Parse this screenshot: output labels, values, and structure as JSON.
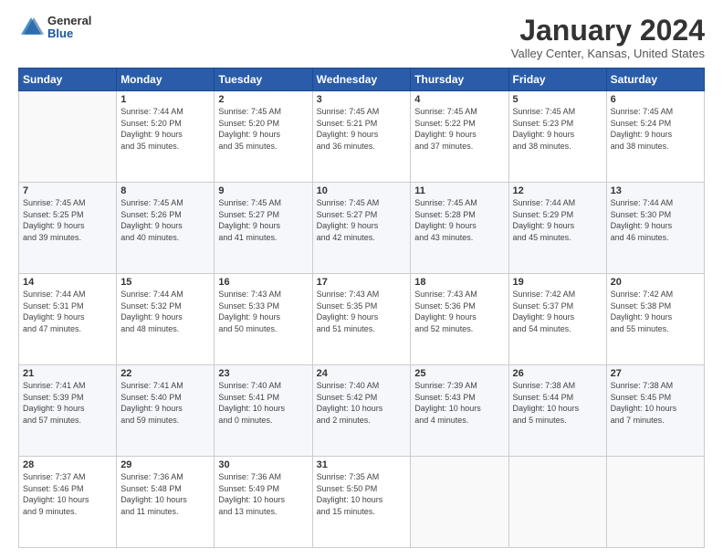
{
  "logo": {
    "general": "General",
    "blue": "Blue"
  },
  "header": {
    "title": "January 2024",
    "location": "Valley Center, Kansas, United States"
  },
  "days_of_week": [
    "Sunday",
    "Monday",
    "Tuesday",
    "Wednesday",
    "Thursday",
    "Friday",
    "Saturday"
  ],
  "weeks": [
    [
      {
        "day": "",
        "info": ""
      },
      {
        "day": "1",
        "info": "Sunrise: 7:44 AM\nSunset: 5:20 PM\nDaylight: 9 hours\nand 35 minutes."
      },
      {
        "day": "2",
        "info": "Sunrise: 7:45 AM\nSunset: 5:20 PM\nDaylight: 9 hours\nand 35 minutes."
      },
      {
        "day": "3",
        "info": "Sunrise: 7:45 AM\nSunset: 5:21 PM\nDaylight: 9 hours\nand 36 minutes."
      },
      {
        "day": "4",
        "info": "Sunrise: 7:45 AM\nSunset: 5:22 PM\nDaylight: 9 hours\nand 37 minutes."
      },
      {
        "day": "5",
        "info": "Sunrise: 7:45 AM\nSunset: 5:23 PM\nDaylight: 9 hours\nand 38 minutes."
      },
      {
        "day": "6",
        "info": "Sunrise: 7:45 AM\nSunset: 5:24 PM\nDaylight: 9 hours\nand 38 minutes."
      }
    ],
    [
      {
        "day": "7",
        "info": "Sunrise: 7:45 AM\nSunset: 5:25 PM\nDaylight: 9 hours\nand 39 minutes."
      },
      {
        "day": "8",
        "info": "Sunrise: 7:45 AM\nSunset: 5:26 PM\nDaylight: 9 hours\nand 40 minutes."
      },
      {
        "day": "9",
        "info": "Sunrise: 7:45 AM\nSunset: 5:27 PM\nDaylight: 9 hours\nand 41 minutes."
      },
      {
        "day": "10",
        "info": "Sunrise: 7:45 AM\nSunset: 5:27 PM\nDaylight: 9 hours\nand 42 minutes."
      },
      {
        "day": "11",
        "info": "Sunrise: 7:45 AM\nSunset: 5:28 PM\nDaylight: 9 hours\nand 43 minutes."
      },
      {
        "day": "12",
        "info": "Sunrise: 7:44 AM\nSunset: 5:29 PM\nDaylight: 9 hours\nand 45 minutes."
      },
      {
        "day": "13",
        "info": "Sunrise: 7:44 AM\nSunset: 5:30 PM\nDaylight: 9 hours\nand 46 minutes."
      }
    ],
    [
      {
        "day": "14",
        "info": "Sunrise: 7:44 AM\nSunset: 5:31 PM\nDaylight: 9 hours\nand 47 minutes."
      },
      {
        "day": "15",
        "info": "Sunrise: 7:44 AM\nSunset: 5:32 PM\nDaylight: 9 hours\nand 48 minutes."
      },
      {
        "day": "16",
        "info": "Sunrise: 7:43 AM\nSunset: 5:33 PM\nDaylight: 9 hours\nand 50 minutes."
      },
      {
        "day": "17",
        "info": "Sunrise: 7:43 AM\nSunset: 5:35 PM\nDaylight: 9 hours\nand 51 minutes."
      },
      {
        "day": "18",
        "info": "Sunrise: 7:43 AM\nSunset: 5:36 PM\nDaylight: 9 hours\nand 52 minutes."
      },
      {
        "day": "19",
        "info": "Sunrise: 7:42 AM\nSunset: 5:37 PM\nDaylight: 9 hours\nand 54 minutes."
      },
      {
        "day": "20",
        "info": "Sunrise: 7:42 AM\nSunset: 5:38 PM\nDaylight: 9 hours\nand 55 minutes."
      }
    ],
    [
      {
        "day": "21",
        "info": "Sunrise: 7:41 AM\nSunset: 5:39 PM\nDaylight: 9 hours\nand 57 minutes."
      },
      {
        "day": "22",
        "info": "Sunrise: 7:41 AM\nSunset: 5:40 PM\nDaylight: 9 hours\nand 59 minutes."
      },
      {
        "day": "23",
        "info": "Sunrise: 7:40 AM\nSunset: 5:41 PM\nDaylight: 10 hours\nand 0 minutes."
      },
      {
        "day": "24",
        "info": "Sunrise: 7:40 AM\nSunset: 5:42 PM\nDaylight: 10 hours\nand 2 minutes."
      },
      {
        "day": "25",
        "info": "Sunrise: 7:39 AM\nSunset: 5:43 PM\nDaylight: 10 hours\nand 4 minutes."
      },
      {
        "day": "26",
        "info": "Sunrise: 7:38 AM\nSunset: 5:44 PM\nDaylight: 10 hours\nand 5 minutes."
      },
      {
        "day": "27",
        "info": "Sunrise: 7:38 AM\nSunset: 5:45 PM\nDaylight: 10 hours\nand 7 minutes."
      }
    ],
    [
      {
        "day": "28",
        "info": "Sunrise: 7:37 AM\nSunset: 5:46 PM\nDaylight: 10 hours\nand 9 minutes."
      },
      {
        "day": "29",
        "info": "Sunrise: 7:36 AM\nSunset: 5:48 PM\nDaylight: 10 hours\nand 11 minutes."
      },
      {
        "day": "30",
        "info": "Sunrise: 7:36 AM\nSunset: 5:49 PM\nDaylight: 10 hours\nand 13 minutes."
      },
      {
        "day": "31",
        "info": "Sunrise: 7:35 AM\nSunset: 5:50 PM\nDaylight: 10 hours\nand 15 minutes."
      },
      {
        "day": "",
        "info": ""
      },
      {
        "day": "",
        "info": ""
      },
      {
        "day": "",
        "info": ""
      }
    ]
  ]
}
